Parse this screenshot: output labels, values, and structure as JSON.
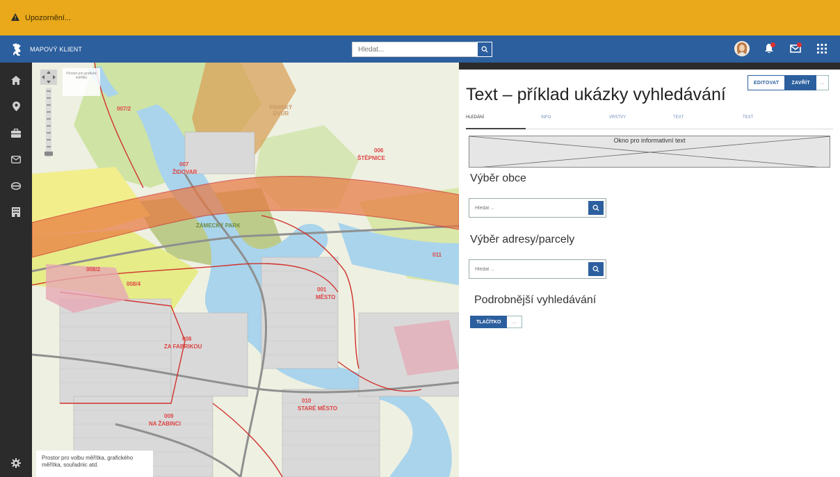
{
  "warning": {
    "text": "Upozornění..."
  },
  "header": {
    "app_title": "MAPOVÝ KLIENT",
    "search_placeholder": "Hledat..."
  },
  "colors": {
    "warning": "#e9a91b",
    "header": "#2c5f9e",
    "sidebar": "#2b2b2b",
    "accent": "#2c5f9e",
    "badge": "#e03131"
  },
  "sidebar": {
    "items": [
      {
        "icon": "home-icon"
      },
      {
        "icon": "location-pin-icon"
      },
      {
        "icon": "briefcase-icon"
      },
      {
        "icon": "mail-icon"
      },
      {
        "icon": "layers-icon"
      },
      {
        "icon": "building-icon"
      }
    ],
    "bottom_icon": "gear-icon"
  },
  "map": {
    "scale_hint": "Prostor pro grafické měřítko",
    "coord_box_text": "Prostor pro volbu měřítka, grafického měřítka, souřadnic atd.",
    "labels": [
      "007/2",
      "007",
      "ŽIDOVAR",
      "006",
      "ŠTĚPNICE",
      "008/2",
      "008/4",
      "008",
      "ZA FABRIKOU",
      "001",
      "MĚSTO",
      "010",
      "STARÉ MĚSTO",
      "009",
      "NA ŽABINCI",
      "ZÁMECKÝ PARK",
      "011",
      "PANSKÝ DVŮR"
    ]
  },
  "panel": {
    "edit_label": "EDITOVAT",
    "close_label": "ZAVŘÍT",
    "more_label": "...",
    "title": "Text – příklad ukázky vyhledávání",
    "tabs": [
      "HLEDÁNÍ",
      "INFO",
      "VRSTVY",
      "TEXT",
      "TEXT"
    ],
    "active_tab": "HLEDÁNÍ",
    "info_text": "Okno pro informativní text",
    "section1_title": "Výběr obce",
    "section1_placeholder": "Hledat ...",
    "section2_title": "Výběr adresy/parcely",
    "section2_placeholder": "Hledat ...",
    "section3_title": "Podrobnější vyhledávání",
    "button_label": "TLAČÍTKO",
    "button_more": "..."
  }
}
